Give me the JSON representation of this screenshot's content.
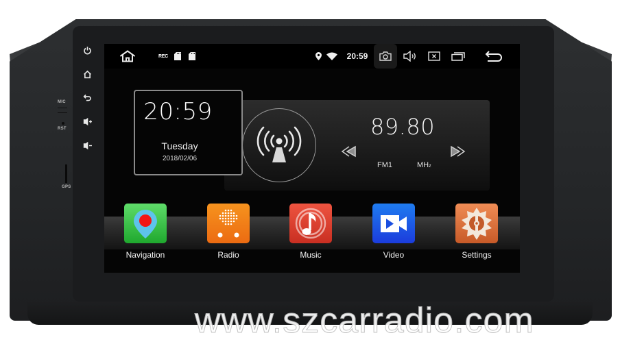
{
  "device": {
    "hardware_labels": {
      "mic": "MIC",
      "rst": "RST",
      "gps": "GPS"
    },
    "side_buttons": [
      {
        "name": "power",
        "icon": "power-icon"
      },
      {
        "name": "home",
        "icon": "home-icon"
      },
      {
        "name": "back",
        "icon": "back-icon"
      },
      {
        "name": "volume-up",
        "icon": "volume-up-icon"
      },
      {
        "name": "volume-down",
        "icon": "volume-down-icon"
      }
    ]
  },
  "statusbar": {
    "left_icons": [
      "home-icon",
      "rec-icon",
      "sd-card-icon",
      "sd-card-icon"
    ],
    "rec_label": "REC",
    "right_icons": [
      "location-icon",
      "wifi-icon",
      "screenshot-icon",
      "volume-icon",
      "close-app-icon",
      "recent-apps-icon",
      "back-icon"
    ],
    "time": "20:59"
  },
  "clock_widget": {
    "time": "20:59",
    "day": "Tuesday",
    "date": "2018/02/06"
  },
  "radio_widget": {
    "frequency": "89.80",
    "band": "FM1",
    "unit": "MHz",
    "unit_display": "MH",
    "unit_sub": "z",
    "icon": "radio-tower-icon",
    "prev_icon": "seek-back-icon",
    "next_icon": "seek-forward-icon"
  },
  "dock": {
    "apps": [
      {
        "label": "Navigation",
        "icon": "navigation-pin-icon",
        "color_top": "#5fdc6a",
        "color_bottom": "#1fa82e"
      },
      {
        "label": "Radio",
        "icon": "radio-dots-icon",
        "color_top": "#f6931e",
        "color_bottom": "#ec6b12"
      },
      {
        "label": "Music",
        "icon": "music-note-icon",
        "color_top": "#ee5440",
        "color_bottom": "#c92f22"
      },
      {
        "label": "Video",
        "icon": "video-camera-icon",
        "color_top": "#1f7cf0",
        "color_bottom": "#1b3cdc"
      },
      {
        "label": "Settings",
        "icon": "settings-gear-icon",
        "color_top": "#ef8c55",
        "color_bottom": "#c75a28"
      }
    ]
  },
  "watermark": "www.szcarradio.com"
}
